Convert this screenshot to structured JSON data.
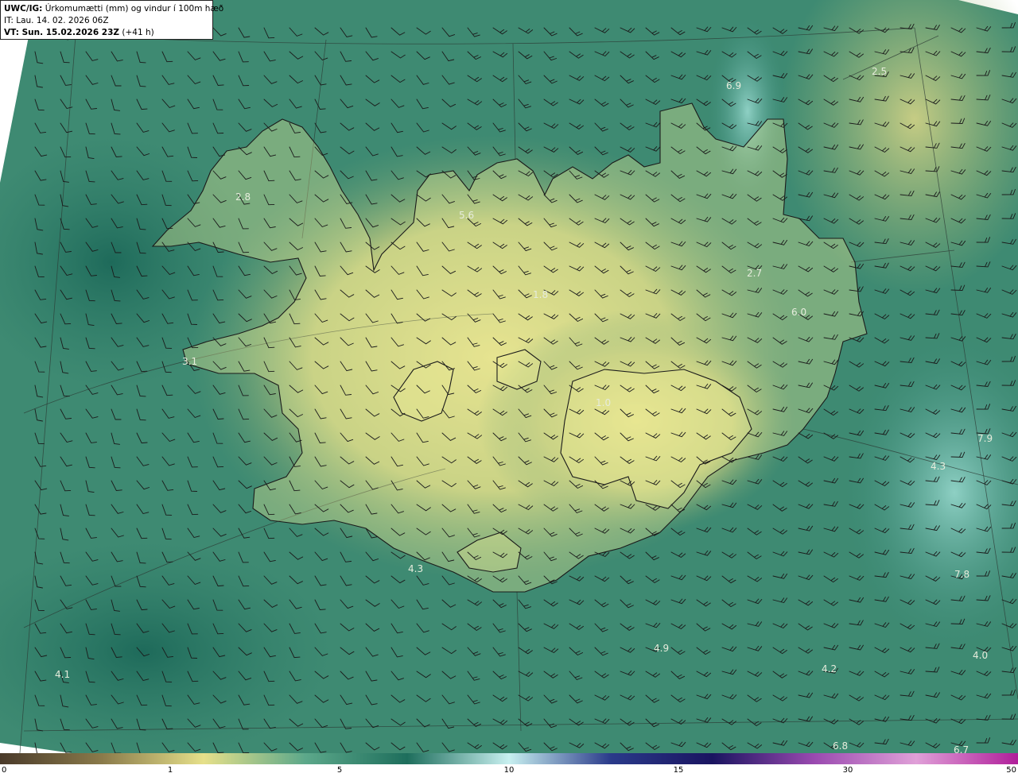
{
  "header": {
    "product": "UWC/IG:",
    "description": "Úrkomumætti (mm) og vindur í 100m hæð",
    "init_time": "IT: Lau. 14. 02. 2026 06Z",
    "valid_prefix": "VT: Sun. 15.02.2026 23Z",
    "valid_suffix": "(+41 h)"
  },
  "map_labels": [
    {
      "text": "6.9"
    },
    {
      "text": "2.5"
    },
    {
      "text": "2.8"
    },
    {
      "text": "5.6"
    },
    {
      "text": "2.7"
    },
    {
      "text": "1.8"
    },
    {
      "text": "6.0"
    },
    {
      "text": "3.1"
    },
    {
      "text": "1.0"
    },
    {
      "text": "7.9"
    },
    {
      "text": "4.3"
    },
    {
      "text": "4.3"
    },
    {
      "text": "7.8"
    },
    {
      "text": "4.9"
    },
    {
      "text": "4.2"
    },
    {
      "text": "4.0"
    },
    {
      "text": "4.1"
    },
    {
      "text": "6.8"
    },
    {
      "text": "6.7"
    }
  ],
  "colorbar": {
    "ticks": [
      "0",
      "1",
      "5",
      "10",
      "15",
      "30",
      "50"
    ],
    "colors": [
      "#4a3a2a",
      "#8a7a4a",
      "#e6e08a",
      "#5ca88a",
      "#1e6e5c",
      "#c8f0f0",
      "#2a3a8a",
      "#1a1460",
      "#9a4ab0",
      "#e0a0d8",
      "#b01e9a"
    ]
  }
}
